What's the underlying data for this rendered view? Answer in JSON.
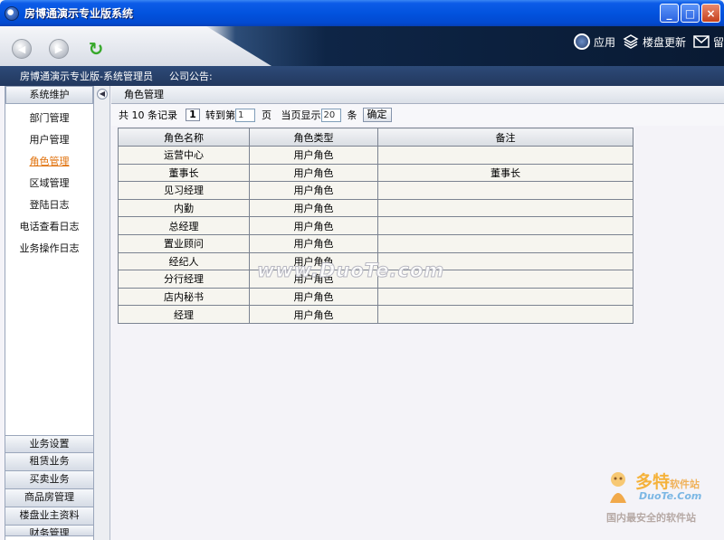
{
  "window": {
    "title": "房博通演示专业版系统",
    "buttons": {
      "minimize": "_",
      "maximize": "□",
      "close": "×"
    }
  },
  "toolbar": {
    "back_icon": "back-arrow-icon",
    "forward_icon": "forward-arrow-icon",
    "refresh_icon": "refresh-icon",
    "items": [
      {
        "label": "应用",
        "icon": "globe-icon"
      },
      {
        "label": "楼盘更新",
        "icon": "layers-icon"
      },
      {
        "label": "留",
        "icon": "mail-icon"
      }
    ]
  },
  "infobar": {
    "user": "房博通演示专业版-系统管理员",
    "notice": "公司公告:"
  },
  "sidebar": {
    "group": "系统维护",
    "items": [
      "部门管理",
      "用户管理",
      "角色管理",
      "区域管理",
      "登陆日志",
      "电话查看日志",
      "业务操作日志"
    ],
    "active_index": 2,
    "bottom_groups": [
      "业务设置",
      "租赁业务",
      "买卖业务",
      "商品房管理",
      "楼盘业主资料",
      "财务管理"
    ]
  },
  "main": {
    "section_title": "角色管理",
    "pager": {
      "total_prefix": "共",
      "total": "10",
      "total_suffix": "条记录",
      "current_page": "1",
      "goto_label": "转到第",
      "goto_value": "1",
      "page_unit": "页",
      "per_page_label": "当页显示",
      "per_page_value": "20",
      "per_page_unit": "条",
      "confirm": "确定"
    },
    "table": {
      "headers": [
        "角色名称",
        "角色类型",
        "备注"
      ],
      "rows": [
        [
          "运营中心",
          "用户角色",
          ""
        ],
        [
          "董事长",
          "用户角色",
          "董事长"
        ],
        [
          "见习经理",
          "用户角色",
          ""
        ],
        [
          "内勤",
          "用户角色",
          ""
        ],
        [
          "总经理",
          "用户角色",
          ""
        ],
        [
          "置业顾问",
          "用户角色",
          ""
        ],
        [
          "经纪人",
          "用户角色",
          ""
        ],
        [
          "分行经理",
          "用户角色",
          ""
        ],
        [
          "店内秘书",
          "用户角色",
          ""
        ],
        [
          "经理",
          "用户角色",
          ""
        ]
      ]
    }
  },
  "watermark": {
    "center": "www.DuoTe.com",
    "brand": "多特",
    "brand_small": "软件站",
    "domain": "DuoTe.Com",
    "slogan": "国内最安全的软件站"
  }
}
